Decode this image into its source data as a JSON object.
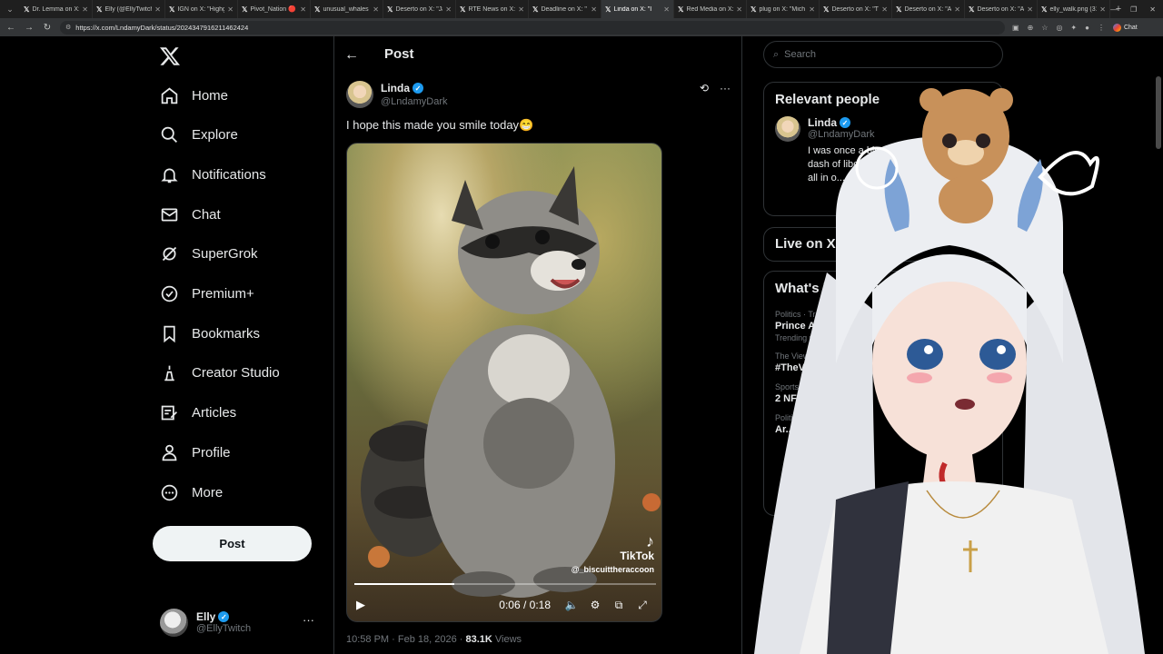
{
  "browser": {
    "tabs": [
      {
        "title": "Dr. Lemma on X: \"",
        "active": false
      },
      {
        "title": "Elly (@EllyTwitch",
        "active": false
      },
      {
        "title": "IGN on X: \"Highg",
        "active": false
      },
      {
        "title": "Pivot_Nation 🔴 o",
        "active": false
      },
      {
        "title": "unusual_whales o",
        "active": false
      },
      {
        "title": "Deserto on X: \"Ja",
        "active": false
      },
      {
        "title": "RTÉ News on X: \"",
        "active": false
      },
      {
        "title": "Deadline on X: \"",
        "active": false
      },
      {
        "title": "Linda on X: \"I",
        "active": true
      },
      {
        "title": "Red Media on X: \"",
        "active": false
      },
      {
        "title": "plug on X: \"Mich",
        "active": false
      },
      {
        "title": "Deserto on X: \"Th",
        "active": false
      },
      {
        "title": "Deserto on X: \"A",
        "active": false
      },
      {
        "title": "Deserto on X: \"Ar",
        "active": false
      },
      {
        "title": "elly_walk.png (31",
        "active": false
      }
    ],
    "url": "https://x.com/LndamyDark/status/2024347916211462424",
    "chat_label": "Chat"
  },
  "nav": {
    "items": [
      {
        "label": "Home",
        "icon": "home-icon"
      },
      {
        "label": "Explore",
        "icon": "search-icon"
      },
      {
        "label": "Notifications",
        "icon": "bell-icon"
      },
      {
        "label": "Chat",
        "icon": "mail-icon"
      },
      {
        "label": "SuperGrok",
        "icon": "grok-icon"
      },
      {
        "label": "Premium+",
        "icon": "premium-icon"
      },
      {
        "label": "Bookmarks",
        "icon": "bookmark-icon"
      },
      {
        "label": "Creator Studio",
        "icon": "creator-icon"
      },
      {
        "label": "Articles",
        "icon": "article-icon"
      },
      {
        "label": "Profile",
        "icon": "person-icon"
      },
      {
        "label": "More",
        "icon": "more-icon"
      }
    ],
    "post_label": "Post"
  },
  "account": {
    "name": "Elly",
    "handle": "@EllyTwitch",
    "more": "···"
  },
  "main": {
    "title": "Post",
    "author": {
      "name": "Linda",
      "handle": "@LndamyDark"
    },
    "text": "I hope this made you smile today😁",
    "video": {
      "current_time": "0:06",
      "duration": "0:18",
      "time_display": "0:06 / 0:18",
      "progress": 0.33,
      "watermark_brand": "TikTok",
      "watermark_handle": "@_biscuittheraccoon"
    },
    "meta_time": "10:58 PM · Feb 18, 2026 · ",
    "views_count": "83.1K",
    "views_label": " Views"
  },
  "right": {
    "search_placeholder": "Search",
    "relevant_title": "Relevant people",
    "person": {
      "name": "Linda",
      "handle": "@LndamyDark",
      "bio": "I was once a blend of co... roots with a dash of liberal sp... Neither label fits... m all in o... DMs? Only ... Typos"
    },
    "live_title": "Live on X",
    "happening_title": "What's happening",
    "trends": [
      {
        "category": "Politics · Trending",
        "title": "Prince A...",
        "sub": "Trending wi..."
      },
      {
        "category": "The View",
        "title": "#TheVi...",
        "sub": ""
      },
      {
        "category": "Sports",
        "title": "2 NFL...",
        "sub": ""
      },
      {
        "category": "Politics",
        "title": "Ar...",
        "sub": ""
      }
    ]
  }
}
